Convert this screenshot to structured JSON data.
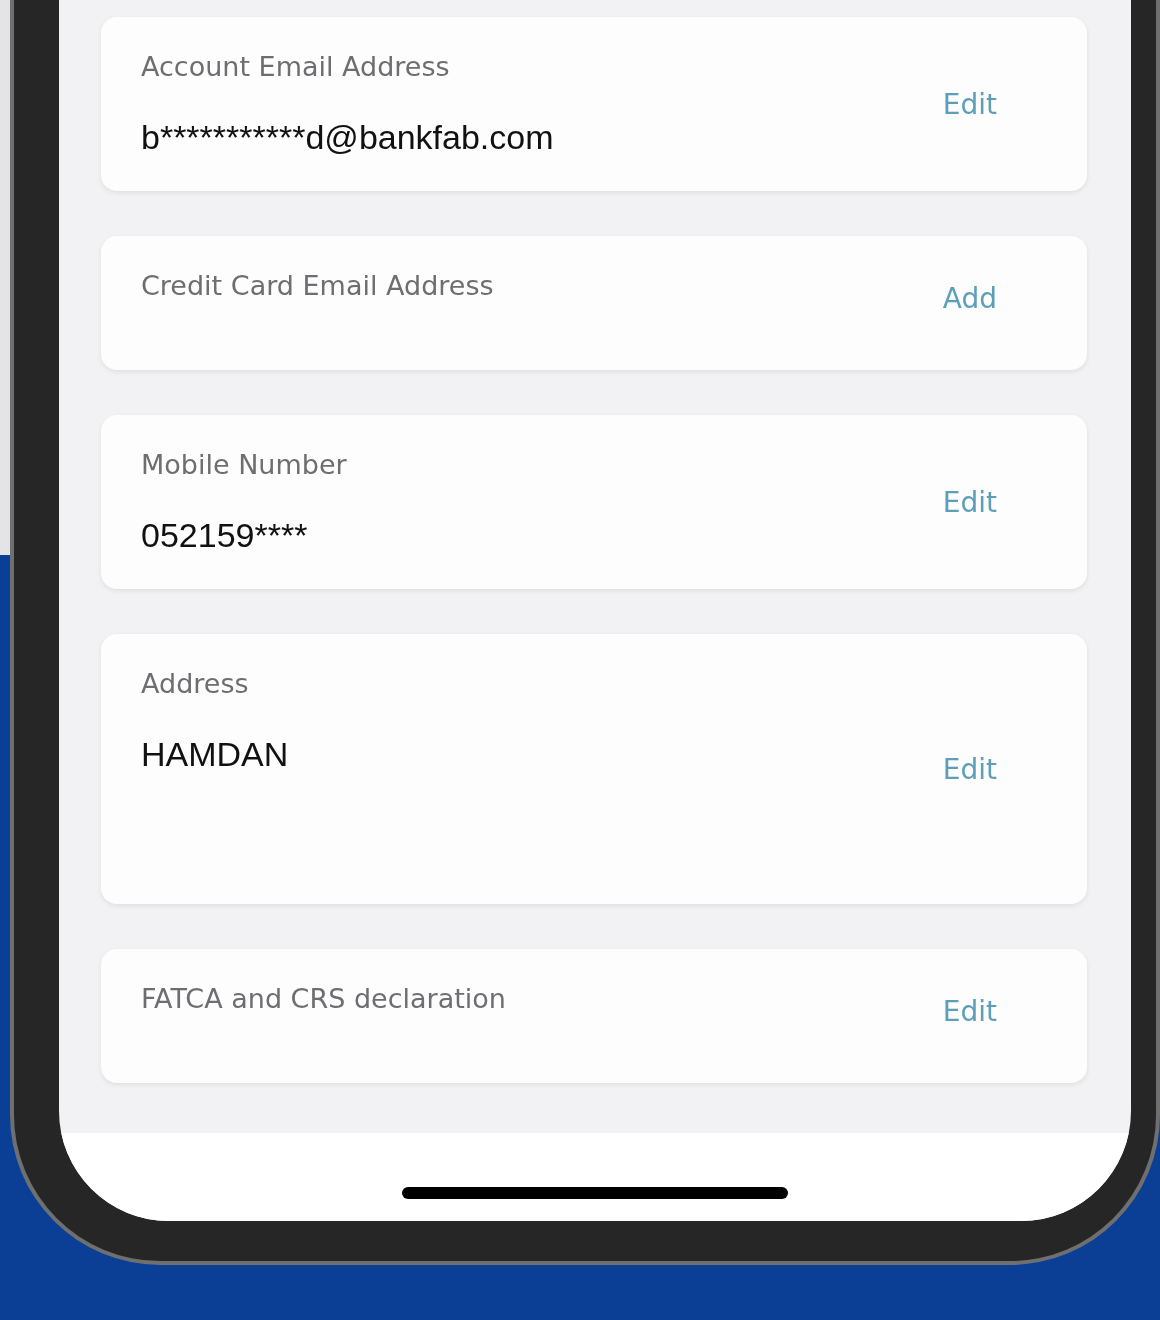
{
  "cards": [
    {
      "label": "Account Email Address",
      "value": "b***********d@bankfab.com",
      "action": "Edit"
    },
    {
      "label": "Credit Card Email Address",
      "action": "Add"
    },
    {
      "label": "Mobile Number",
      "value": "052159****",
      "action": "Edit"
    },
    {
      "label": "Address",
      "value": "HAMDAN",
      "action": "Edit"
    },
    {
      "label": "FATCA and CRS declaration",
      "action": "Edit"
    }
  ]
}
